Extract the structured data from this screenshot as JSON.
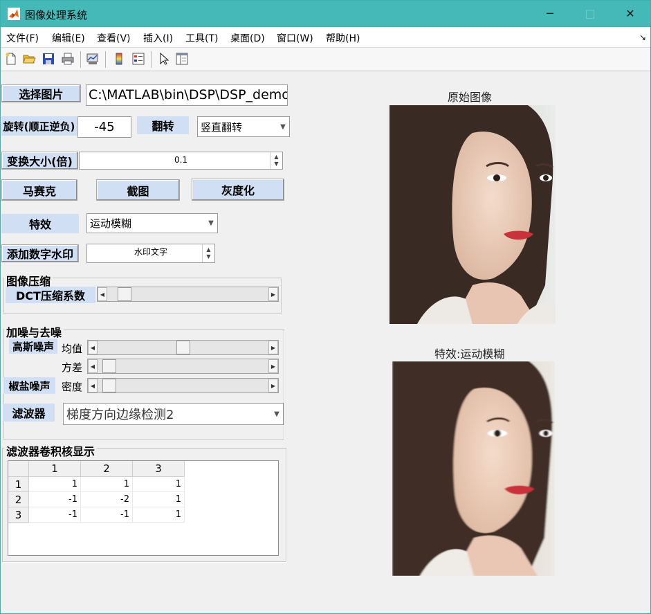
{
  "window": {
    "title": "图像处理系统",
    "min_glyph": "─",
    "max_glyph": "□",
    "close_glyph": "✕"
  },
  "menubar": {
    "items": [
      "文件(F)",
      "编辑(E)",
      "查看(V)",
      "插入(I)",
      "工具(T)",
      "桌面(D)",
      "窗口(W)",
      "帮助(H)"
    ],
    "overflow_glyph": "↘"
  },
  "toolbar": {
    "icons": [
      "new-file-icon",
      "open-folder-icon",
      "save-icon",
      "print-icon",
      "link-plot-icon",
      "colorbar-icon",
      "legend-icon",
      "pointer-icon",
      "property-editor-icon"
    ]
  },
  "controls": {
    "select_image_label": "选择图片",
    "image_path": "C:\\MATLAB\\bin\\DSP\\DSP_demo",
    "rotate_label": "旋转(顺正逆负)",
    "rotate_value": "-45",
    "flip_label": "翻转",
    "flip_selected": "竖直翻转",
    "resize_label": "变换大小(倍)",
    "resize_value": "0.1",
    "mosaic_label": "马赛克",
    "crop_label": "截图",
    "gray_label": "灰度化",
    "effect_label": "特效",
    "effect_selected": "运动模糊",
    "watermark_label": "添加数字水印",
    "watermark_value": "水印文字"
  },
  "compression": {
    "title": "图像压缩",
    "dct_label": "DCT压缩系数",
    "dct_level": 0.07
  },
  "noise": {
    "title": "加噪与去噪",
    "gauss_label": "高斯噪声",
    "mean_label": "均值",
    "mean_level": 0.5,
    "variance_label": "方差",
    "variance_level": 0.03,
    "saltpepper_label": "椒盐噪声",
    "density_label": "密度",
    "density_level": 0.03,
    "filter_label": "滤波器",
    "filter_selected": "梯度方向边缘检测2"
  },
  "kernel": {
    "title": "滤波器卷积核显示",
    "columns": [
      "1",
      "2",
      "3"
    ],
    "rows": [
      {
        "label": "1",
        "cells": [
          "1",
          "1",
          "1"
        ]
      },
      {
        "label": "2",
        "cells": [
          "-1",
          "-2",
          "1"
        ]
      },
      {
        "label": "3",
        "cells": [
          "-1",
          "-1",
          "1"
        ]
      }
    ]
  },
  "images": {
    "original_title": "原始图像",
    "effect_title": "特效:运动模糊"
  },
  "colors": {
    "titlebar": "#45b8b8",
    "button": "#d0dff3",
    "background": "#f0f0f0"
  }
}
